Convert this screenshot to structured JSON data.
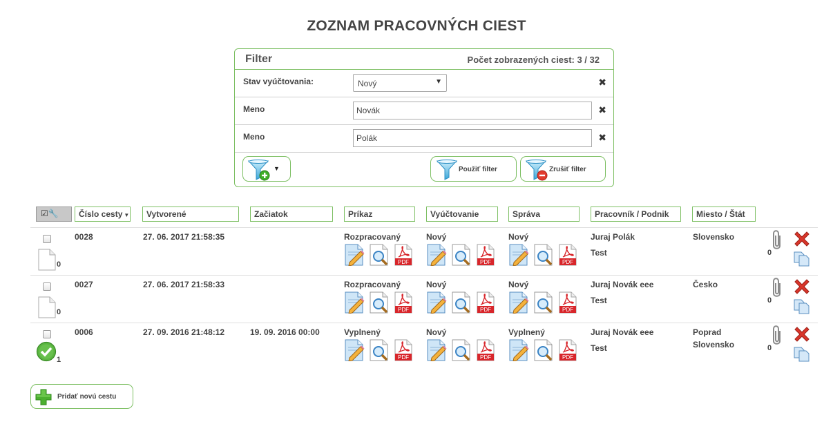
{
  "page": {
    "title": "ZOZNAM PRACOVNÝCH CIEST"
  },
  "filter": {
    "title": "Filter",
    "count_text": "Počet zobrazených ciest: 3 / 32",
    "rows": [
      {
        "label": "Stav vyúčtovania:",
        "type": "select",
        "value": "Nový"
      },
      {
        "label": "Meno",
        "type": "text",
        "value": "Novák"
      },
      {
        "label": "Meno",
        "type": "text",
        "value": "Polák"
      }
    ],
    "apply_label": "Použiť filter",
    "cancel_label": "Zrušiť filter"
  },
  "table": {
    "headers": {
      "number": "Číslo cesty",
      "created": "Vytvorené",
      "start": "Začiatok",
      "order": "Príkaz",
      "settlement": "Vyúčtovanie",
      "report": "Správa",
      "worker": "Pracovník / Podnik",
      "place": "Miesto / Štát"
    },
    "rows": [
      {
        "number": "0028",
        "created": "27. 06. 2017 21:58:35",
        "start": "",
        "order": "Rozpracovaný",
        "settlement": "Nový",
        "report": "Nový",
        "worker": "Juraj Polák",
        "company": "Test",
        "place": "Slovensko",
        "place2": "",
        "doc_count": "0",
        "attachment_count": "0",
        "approved": false
      },
      {
        "number": "0027",
        "created": "27. 06. 2017 21:58:33",
        "start": "",
        "order": "Rozpracovaný",
        "settlement": "Nový",
        "report": "Nový",
        "worker": "Juraj Novák eee",
        "company": "Test",
        "place": "Česko",
        "place2": "",
        "doc_count": "0",
        "attachment_count": "0",
        "approved": false
      },
      {
        "number": "0006",
        "created": "27. 09. 2016 21:48:12",
        "start": "19. 09. 2016 00:00",
        "order": "Vyplnený",
        "settlement": "Nový",
        "report": "Vyplnený",
        "worker": "Juraj Novák eee",
        "company": "Test",
        "place": "Poprad",
        "place2": "Slovensko",
        "doc_count": "1",
        "attachment_count": "0",
        "approved": true
      }
    ]
  },
  "add_button": {
    "label": "Pridať novú cestu"
  },
  "icons": {
    "edit": "edit-document-icon",
    "view": "view-document-icon",
    "pdf": "pdf-icon",
    "attachment": "paperclip-icon",
    "delete": "delete-icon",
    "copy": "copy-icon"
  },
  "colors": {
    "accent_green": "#7cbf62",
    "delete_red": "#d9362b",
    "pdf_red": "#d8262b"
  }
}
